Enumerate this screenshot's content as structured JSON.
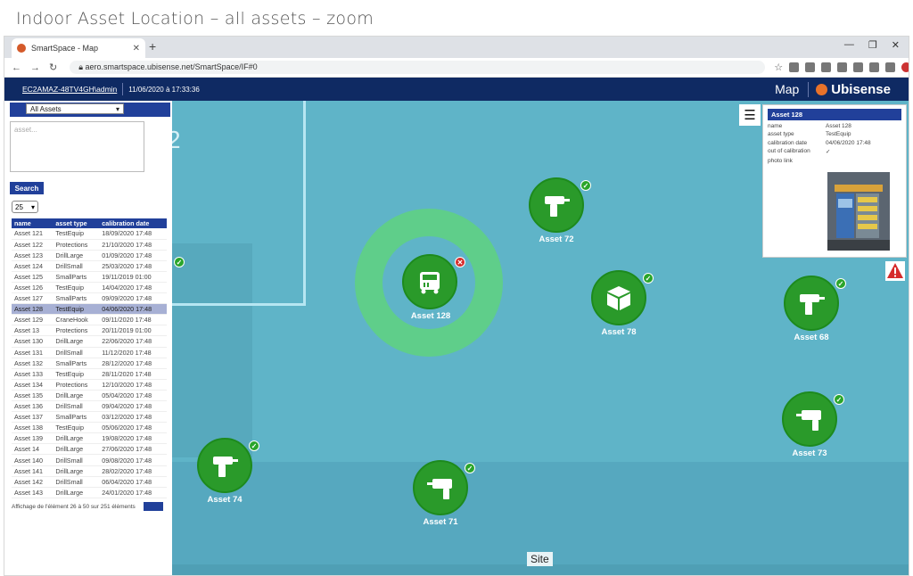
{
  "slide_title": "Indoor Asset Location – all assets – zoom",
  "browser": {
    "tab_title": "SmartSpace - Map",
    "url": "aero.smartspace.ubisense.net/SmartSpace/IF#0"
  },
  "appbar": {
    "user": "EC2AMAZ-48TV4GH\\admin",
    "datetime": "11/06/2020 à 17:33:36",
    "title": "Map",
    "brand": "Ubisense"
  },
  "sidebar": {
    "filter_selected": "All Assets",
    "search_placeholder": "asset...",
    "search_button": "Search",
    "page_size": "25",
    "columns": [
      "name",
      "asset type",
      "calibration date"
    ],
    "rows": [
      [
        "Asset 121",
        "TestEquip",
        "18/09/2020 17:48"
      ],
      [
        "Asset 122",
        "Protections",
        "21/10/2020 17:48"
      ],
      [
        "Asset 123",
        "DrillLarge",
        "01/09/2020 17:48"
      ],
      [
        "Asset 124",
        "DrillSmall",
        "25/03/2020 17:48"
      ],
      [
        "Asset 125",
        "SmallParts",
        "19/11/2019 01:00"
      ],
      [
        "Asset 126",
        "TestEquip",
        "14/04/2020 17:48"
      ],
      [
        "Asset 127",
        "SmallParts",
        "09/09/2020 17:48"
      ],
      [
        "Asset 128",
        "TestEquip",
        "04/06/2020 17:48"
      ],
      [
        "Asset 129",
        "CraneHook",
        "09/11/2020 17:48"
      ],
      [
        "Asset 13",
        "Protections",
        "20/11/2019 01:00"
      ],
      [
        "Asset 130",
        "DrillLarge",
        "22/06/2020 17:48"
      ],
      [
        "Asset 131",
        "DrillSmall",
        "11/12/2020 17:48"
      ],
      [
        "Asset 132",
        "SmallParts",
        "28/12/2020 17:48"
      ],
      [
        "Asset 133",
        "TestEquip",
        "28/11/2020 17:48"
      ],
      [
        "Asset 134",
        "Protections",
        "12/10/2020 17:48"
      ],
      [
        "Asset 135",
        "DrillLarge",
        "05/04/2020 17:48"
      ],
      [
        "Asset 136",
        "DrillSmall",
        "09/04/2020 17:48"
      ],
      [
        "Asset 137",
        "SmallParts",
        "03/12/2020 17:48"
      ],
      [
        "Asset 138",
        "TestEquip",
        "05/06/2020 17:48"
      ],
      [
        "Asset 139",
        "DrillLarge",
        "19/08/2020 17:48"
      ],
      [
        "Asset 14",
        "DrillLarge",
        "27/06/2020 17:48"
      ],
      [
        "Asset 140",
        "DrillSmall",
        "09/08/2020 17:48"
      ],
      [
        "Asset 141",
        "DrillLarge",
        "28/02/2020 17:48"
      ],
      [
        "Asset 142",
        "DrillSmall",
        "06/04/2020 17:48"
      ],
      [
        "Asset 143",
        "DrillLarge",
        "24/01/2020 17:48"
      ]
    ],
    "pager_text": "Affichage de l'élément 26 à 50 sur 251 éléments"
  },
  "map": {
    "room_number": "2",
    "site_label": "Site",
    "assets": {
      "a128": "Asset 128",
      "a72": "Asset 72",
      "a78": "Asset 78",
      "a68": "Asset 68",
      "a73": "Asset 73",
      "a74": "Asset 74",
      "a71": "Asset 71"
    }
  },
  "info_panel": {
    "title": "Asset 128",
    "name_label": "name",
    "name_value": "Asset 128",
    "type_label": "asset type",
    "type_value": "TestEquip",
    "date_label": "calibration date",
    "date_value": "04/06/2020 17:48",
    "oc_label": "out of calibration",
    "oc_value": "✓",
    "photo_label": "photo link"
  },
  "colors": {
    "navy": "#0f2a63",
    "accent_blue": "#21409a",
    "map_bg": "#5fb4c8",
    "asset_green": "#2a9a2a",
    "ring_green": "#5fce8a",
    "error_red": "#d62b2b"
  }
}
